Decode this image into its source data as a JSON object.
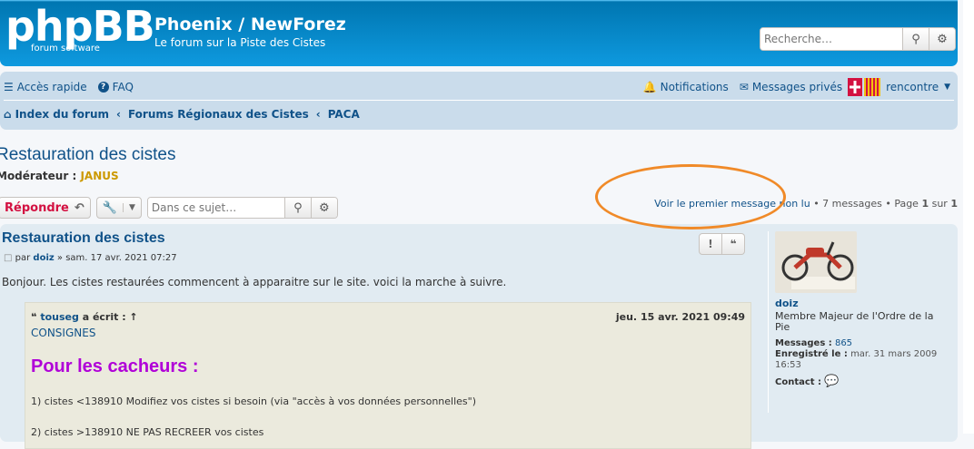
{
  "header": {
    "logo_text": "phpBB",
    "logo_sub": "forum software",
    "title": "Phoenix / NewForez",
    "subtitle": "Le forum sur la Piste des Cistes",
    "search_placeholder": "Recherche…"
  },
  "nav": {
    "quick_access": "Accès rapide",
    "faq": "FAQ",
    "notifications": "Notifications",
    "private_messages": "Messages privés",
    "username": "rencontre"
  },
  "breadcrumb": [
    "Index du forum",
    "Forums Régionaux des Cistes",
    "PACA"
  ],
  "topic": {
    "title": "Restauration des cistes",
    "moderator_label": "Modérateur :",
    "moderator_name": "JANUS",
    "reply_label": "Répondre",
    "search_placeholder": "Dans ce sujet…",
    "first_unread": "Voir le premier message non lu",
    "message_count": "• 7 messages • Page",
    "page_current": "1",
    "page_of": "sur",
    "page_total": "1"
  },
  "post": {
    "title": "Restauration des cistes",
    "by_label": "par",
    "author": "doiz",
    "date": "» sam. 17 avr. 2021 07:27",
    "body": "Bonjour. Les cistes restaurées commencent à apparaitre sur le site. voici la marche à suivre.",
    "quote": {
      "author": "touseg",
      "wrote": "a écrit : ↑",
      "date": "jeu. 15 avr. 2021 09:49",
      "consignes": "CONSIGNES",
      "heading": "Pour les cacheurs :",
      "line1": "1) cistes <138910 Modifiez vos cistes si besoin (via \"accès à vos données personnelles\")",
      "line2": "2) cistes >138910 NE PAS RECREER vos cistes"
    }
  },
  "profile": {
    "name": "doiz",
    "rank": "Membre Majeur de l'Ordre de la Pie",
    "messages_label": "Messages :",
    "messages_value": "865",
    "registered_label": "Enregistré le :",
    "registered_value": "mar. 31 mars 2009 16:53",
    "contact_label": "Contact :"
  },
  "colors": {
    "header_blue": "#12a3eb",
    "nav_bg": "#cadceb",
    "post_bg": "#e1ebf2",
    "link": "#105289",
    "reply_red": "#d31141",
    "quote_heading": "#b000d8",
    "annotation": "#f08a28"
  }
}
